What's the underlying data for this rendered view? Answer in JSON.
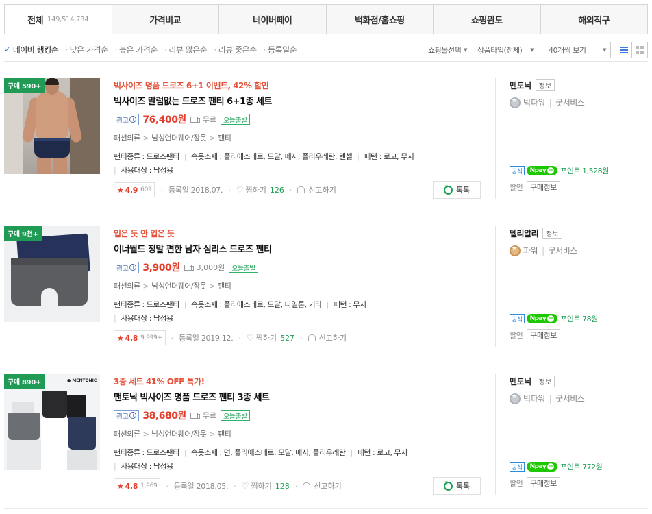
{
  "tabs": [
    {
      "label": "전체",
      "count": "149,514,734"
    },
    {
      "label": "가격비교"
    },
    {
      "label": "네이버페이"
    },
    {
      "label": "백화점/홈쇼핑"
    },
    {
      "label": "쇼핑윈도"
    },
    {
      "label": "해외직구"
    }
  ],
  "sort": {
    "options": [
      "네이버 랭킹순",
      "낮은 가격순",
      "높은 가격순",
      "리뷰 많은순",
      "리뷰 좋은순",
      "등록일순"
    ],
    "active_index": 0
  },
  "filters": {
    "mall_select": "쇼핑몰선택",
    "product_type": "상품타입(전체)",
    "page_size": "40개씩 보기"
  },
  "products": [
    {
      "buy_badge": "구매 590+",
      "promo": "빅사이즈 명품 드로즈 6+1 이벤트, 42% 할인",
      "title": "빅사이즈 말럼없는 드로즈 팬티 6+1종 세트",
      "ad_label": "광고",
      "price": "76,400원",
      "shipping": "무료",
      "today_ship": "오늘출발",
      "category": [
        "패션의류",
        "남성언더웨어/잠옷",
        "팬티"
      ],
      "specs": [
        "팬티종류 : 드로즈팬티",
        "속옷소재 : 폴리에스테르, 모달, 메시, 폴리우레탄, 텐셀",
        "패턴 : 로고, 무지",
        "사용대상 : 남성용"
      ],
      "rating": "4.9",
      "review_count": "609",
      "reg_date": "등록일 2018.07.",
      "zzim_label": "찜하기",
      "zzim_count": "126",
      "report_label": "신고하기",
      "talk_label": "톡톡",
      "seller": {
        "name": "맨토닉",
        "info_label": "정보",
        "grade": "빅파워",
        "grade_medal": "silver",
        "service": "굿서비스",
        "official": "공식",
        "npay": "pay",
        "point": "포인트 1,528원",
        "discount": "할인",
        "buy_info": "구매정보"
      }
    },
    {
      "buy_badge": "구매 9천+",
      "promo": "입은 듯 안 입은 듯",
      "title": "이너월드 정말 편한 남자 심리스 드로즈 팬티",
      "ad_label": "광고",
      "price": "3,900원",
      "shipping": "3,000원",
      "today_ship": "오늘출발",
      "category": [
        "패션의류",
        "남성언더웨어/잠옷",
        "팬티"
      ],
      "specs": [
        "팬티종류 : 드로즈팬티",
        "속옷소재 : 폴리에스테르, 모달, 나일론, 기타",
        "패턴 : 무지",
        "사용대상 : 남성용"
      ],
      "rating": "4.8",
      "review_count": "9,999+",
      "reg_date": "등록일 2019.12.",
      "zzim_label": "찜하기",
      "zzim_count": "527",
      "report_label": "신고하기",
      "talk_label": "",
      "seller": {
        "name": "델리알리",
        "info_label": "정보",
        "grade": "파워",
        "grade_medal": "bronze",
        "service": "굿서비스",
        "official": "공식",
        "npay": "pay",
        "point": "포인트 78원",
        "discount": "할인",
        "buy_info": "구매정보"
      }
    },
    {
      "buy_badge": "구매 890+",
      "promo": "3종 세트 41% OFF 특가!",
      "title": "맨토닉 빅사이즈 명품 드로즈 팬티 3종 세트",
      "ad_label": "광고",
      "price": "38,680원",
      "shipping": "무료",
      "today_ship": "오늘출발",
      "category": [
        "패션의류",
        "남성언더웨어/잠옷",
        "팬티"
      ],
      "specs": [
        "팬티종류 : 드로즈팬티",
        "속옷소재 : 면, 폴리에스테르, 모달, 메시, 폴리우레탄",
        "패턴 : 로고, 무지",
        "사용대상 : 남성용"
      ],
      "rating": "4.8",
      "review_count": "1,969",
      "reg_date": "등록일 2018.05.",
      "zzim_label": "찜하기",
      "zzim_count": "128",
      "report_label": "신고하기",
      "talk_label": "톡톡",
      "image_brand": "● MENTONIC",
      "seller": {
        "name": "맨토닉",
        "info_label": "정보",
        "grade": "빅파워",
        "grade_medal": "silver",
        "service": "굿서비스",
        "official": "공식",
        "npay": "pay",
        "point": "포인트 772원",
        "discount": "할인",
        "buy_info": "구매정보"
      }
    }
  ]
}
